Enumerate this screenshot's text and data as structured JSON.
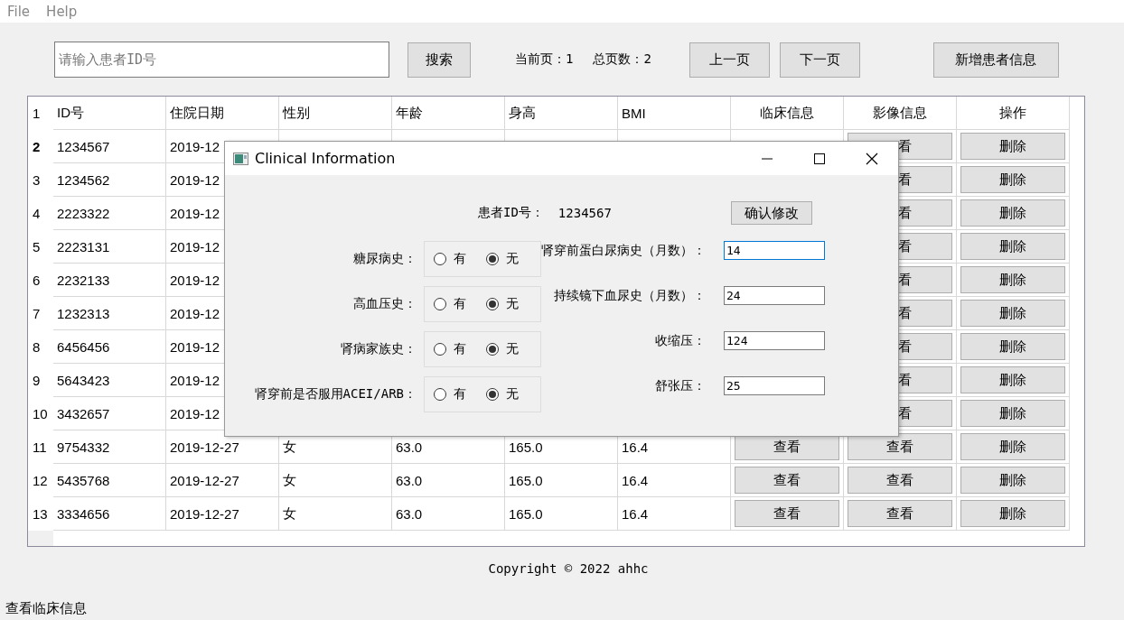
{
  "menu": [
    "File",
    "Help"
  ],
  "toolbar": {
    "search": {
      "placeholder": "请输入患者ID号"
    },
    "search_button": "搜索",
    "current_page": "当前页：1",
    "total_pages": "总页数：2",
    "prev_button": "上一页",
    "next_button": "下一页",
    "add_button": "新增患者信息"
  },
  "table": {
    "rows": [
      {
        "number": "1",
        "current": false,
        "cells": [
          {
            "kind": "text",
            "text": "ID号"
          },
          {
            "kind": "text",
            "text": "住院日期"
          },
          {
            "kind": "text",
            "text": "性别"
          },
          {
            "kind": "text",
            "text": "年龄"
          },
          {
            "kind": "text",
            "text": "身高"
          },
          {
            "kind": "text",
            "text": "BMI"
          },
          {
            "kind": "heading",
            "text": "临床信息"
          },
          {
            "kind": "heading",
            "text": "影像信息"
          },
          {
            "kind": "heading",
            "text": "操作"
          }
        ]
      },
      {
        "number": "2",
        "current": true,
        "cells": [
          {
            "kind": "text",
            "text": "1234567"
          },
          {
            "kind": "text",
            "text": "2019-12"
          },
          null,
          null,
          null,
          null,
          null,
          {
            "kind": "partial-button",
            "text": "看"
          },
          {
            "kind": "button",
            "text": "删除"
          }
        ]
      },
      {
        "number": "3",
        "current": false,
        "cells": [
          {
            "kind": "text",
            "text": "1234562"
          },
          {
            "kind": "text",
            "text": "2019-12"
          },
          null,
          null,
          null,
          null,
          null,
          {
            "kind": "partial-button",
            "text": "看"
          },
          {
            "kind": "button",
            "text": "删除"
          }
        ]
      },
      {
        "number": "4",
        "current": false,
        "cells": [
          {
            "kind": "text",
            "text": "2223322"
          },
          {
            "kind": "text",
            "text": "2019-12"
          },
          null,
          null,
          null,
          null,
          null,
          {
            "kind": "partial-button",
            "text": "看"
          },
          {
            "kind": "button",
            "text": "删除"
          }
        ]
      },
      {
        "number": "5",
        "current": false,
        "cells": [
          {
            "kind": "text",
            "text": "2223131"
          },
          {
            "kind": "text",
            "text": "2019-12"
          },
          null,
          null,
          null,
          null,
          null,
          {
            "kind": "partial-button",
            "text": "看"
          },
          {
            "kind": "button",
            "text": "删除"
          }
        ]
      },
      {
        "number": "6",
        "current": false,
        "cells": [
          {
            "kind": "text",
            "text": "2232133"
          },
          {
            "kind": "text",
            "text": "2019-12"
          },
          null,
          null,
          null,
          null,
          null,
          {
            "kind": "partial-button",
            "text": "看"
          },
          {
            "kind": "button",
            "text": "删除"
          }
        ]
      },
      {
        "number": "7",
        "current": false,
        "cells": [
          {
            "kind": "text",
            "text": "1232313"
          },
          {
            "kind": "text",
            "text": "2019-12"
          },
          null,
          null,
          null,
          null,
          null,
          {
            "kind": "partial-button",
            "text": "看"
          },
          {
            "kind": "button",
            "text": "删除"
          }
        ]
      },
      {
        "number": "8",
        "current": false,
        "cells": [
          {
            "kind": "text",
            "text": "6456456"
          },
          {
            "kind": "text",
            "text": "2019-12"
          },
          null,
          null,
          null,
          null,
          null,
          {
            "kind": "partial-button",
            "text": "看"
          },
          {
            "kind": "button",
            "text": "删除"
          }
        ]
      },
      {
        "number": "9",
        "current": false,
        "cells": [
          {
            "kind": "text",
            "text": "5643423"
          },
          {
            "kind": "text",
            "text": "2019-12"
          },
          null,
          null,
          null,
          null,
          null,
          {
            "kind": "partial-button",
            "text": "看"
          },
          {
            "kind": "button",
            "text": "删除"
          }
        ]
      },
      {
        "number": "10",
        "current": false,
        "cells": [
          {
            "kind": "text",
            "text": "3432657"
          },
          {
            "kind": "text",
            "text": "2019-12"
          },
          null,
          null,
          null,
          null,
          null,
          {
            "kind": "partial-button",
            "text": "看"
          },
          {
            "kind": "button",
            "text": "删除"
          }
        ]
      },
      {
        "number": "11",
        "current": false,
        "cells": [
          {
            "kind": "text",
            "text": "9754332"
          },
          {
            "kind": "text",
            "text": "2019-12-27"
          },
          {
            "kind": "text",
            "text": "女"
          },
          {
            "kind": "text",
            "text": "63.0"
          },
          {
            "kind": "text",
            "text": "165.0"
          },
          {
            "kind": "text",
            "text": "16.4"
          },
          {
            "kind": "button",
            "text": "查看"
          },
          {
            "kind": "button",
            "text": "查看"
          },
          {
            "kind": "button",
            "text": "删除"
          }
        ]
      },
      {
        "number": "12",
        "current": false,
        "cells": [
          {
            "kind": "text",
            "text": "5435768"
          },
          {
            "kind": "text",
            "text": "2019-12-27"
          },
          {
            "kind": "text",
            "text": "女"
          },
          {
            "kind": "text",
            "text": "63.0"
          },
          {
            "kind": "text",
            "text": "165.0"
          },
          {
            "kind": "text",
            "text": "16.4"
          },
          {
            "kind": "button",
            "text": "查看"
          },
          {
            "kind": "button",
            "text": "查看"
          },
          {
            "kind": "button",
            "text": "删除"
          }
        ]
      },
      {
        "number": "13",
        "current": false,
        "cells": [
          {
            "kind": "text",
            "text": "3334656"
          },
          {
            "kind": "text",
            "text": "2019-12-27"
          },
          {
            "kind": "text",
            "text": "女"
          },
          {
            "kind": "text",
            "text": "63.0"
          },
          {
            "kind": "text",
            "text": "165.0"
          },
          {
            "kind": "text",
            "text": "16.4"
          },
          {
            "kind": "button",
            "text": "查看"
          },
          {
            "kind": "button",
            "text": "查看"
          },
          {
            "kind": "button",
            "text": "删除"
          }
        ]
      }
    ]
  },
  "dialog": {
    "title": "Clinical Information",
    "patient_id_label": "患者ID号：",
    "patient_id": "1234567",
    "confirm_button": "确认修改",
    "radio_groups": [
      {
        "label": "糖尿病史：",
        "options": [
          {
            "label": "有",
            "selected": false
          },
          {
            "label": "无",
            "selected": true
          }
        ]
      },
      {
        "label": "高血压史：",
        "options": [
          {
            "label": "有",
            "selected": false
          },
          {
            "label": "无",
            "selected": true
          }
        ]
      },
      {
        "label": "肾病家族史：",
        "options": [
          {
            "label": "有",
            "selected": false
          },
          {
            "label": "无",
            "selected": true
          }
        ]
      },
      {
        "label": "肾穿前是否服用ACEI/ARB：",
        "options": [
          {
            "label": "有",
            "selected": false
          },
          {
            "label": "无",
            "selected": true
          }
        ]
      }
    ],
    "fields": [
      {
        "label": "肾穿前蛋白尿病史（月数）：",
        "value": "14",
        "focused": true
      },
      {
        "label": "持续镜下血尿史（月数）：",
        "value": "24",
        "focused": false
      },
      {
        "label": "收缩压：",
        "value": "124",
        "focused": false
      },
      {
        "label": "舒张压：",
        "value": "25",
        "focused": false
      }
    ]
  },
  "footer": {
    "copyright": "Copyright © 2022 ahhc"
  },
  "status_bar": "查看临床信息"
}
